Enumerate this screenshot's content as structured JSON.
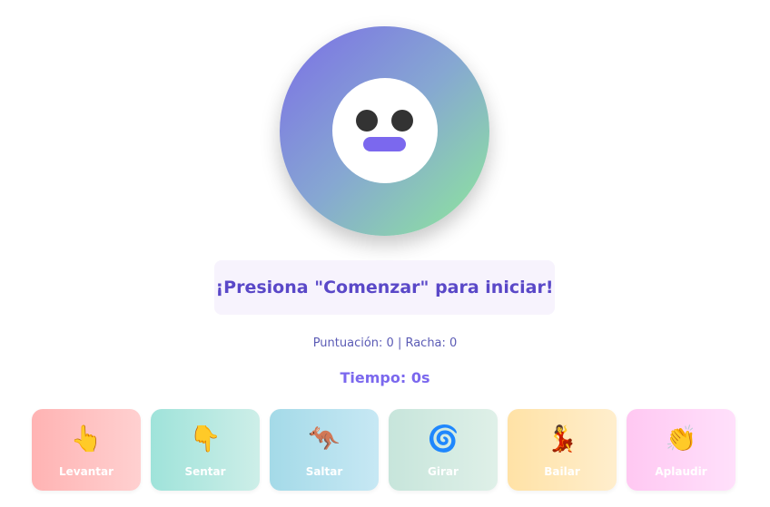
{
  "status": {
    "message": "¡Presiona \"Comenzar\" para iniciar!",
    "score_text": "Puntuación: 0 | Racha: 0",
    "timer_text": "Tiempo: 0s"
  },
  "actions": [
    {
      "label": "Levantar",
      "icon": "👆",
      "icon_name": "pointing-up-icon"
    },
    {
      "label": "Sentar",
      "icon": "👇",
      "icon_name": "pointing-down-icon"
    },
    {
      "label": "Saltar",
      "icon": "🦘",
      "icon_name": "kangaroo-icon"
    },
    {
      "label": "Girar",
      "icon": "🌀",
      "icon_name": "cyclone-icon"
    },
    {
      "label": "Bailar",
      "icon": "💃",
      "icon_name": "dancer-icon"
    },
    {
      "label": "Aplaudir",
      "icon": "👏",
      "icon_name": "clapping-hands-icon"
    }
  ],
  "colors": {
    "accent": "#7b68ee",
    "message_text": "#5a48c8",
    "avatar_gradient": [
      "#7b6ee6",
      "#8ee99a"
    ]
  }
}
